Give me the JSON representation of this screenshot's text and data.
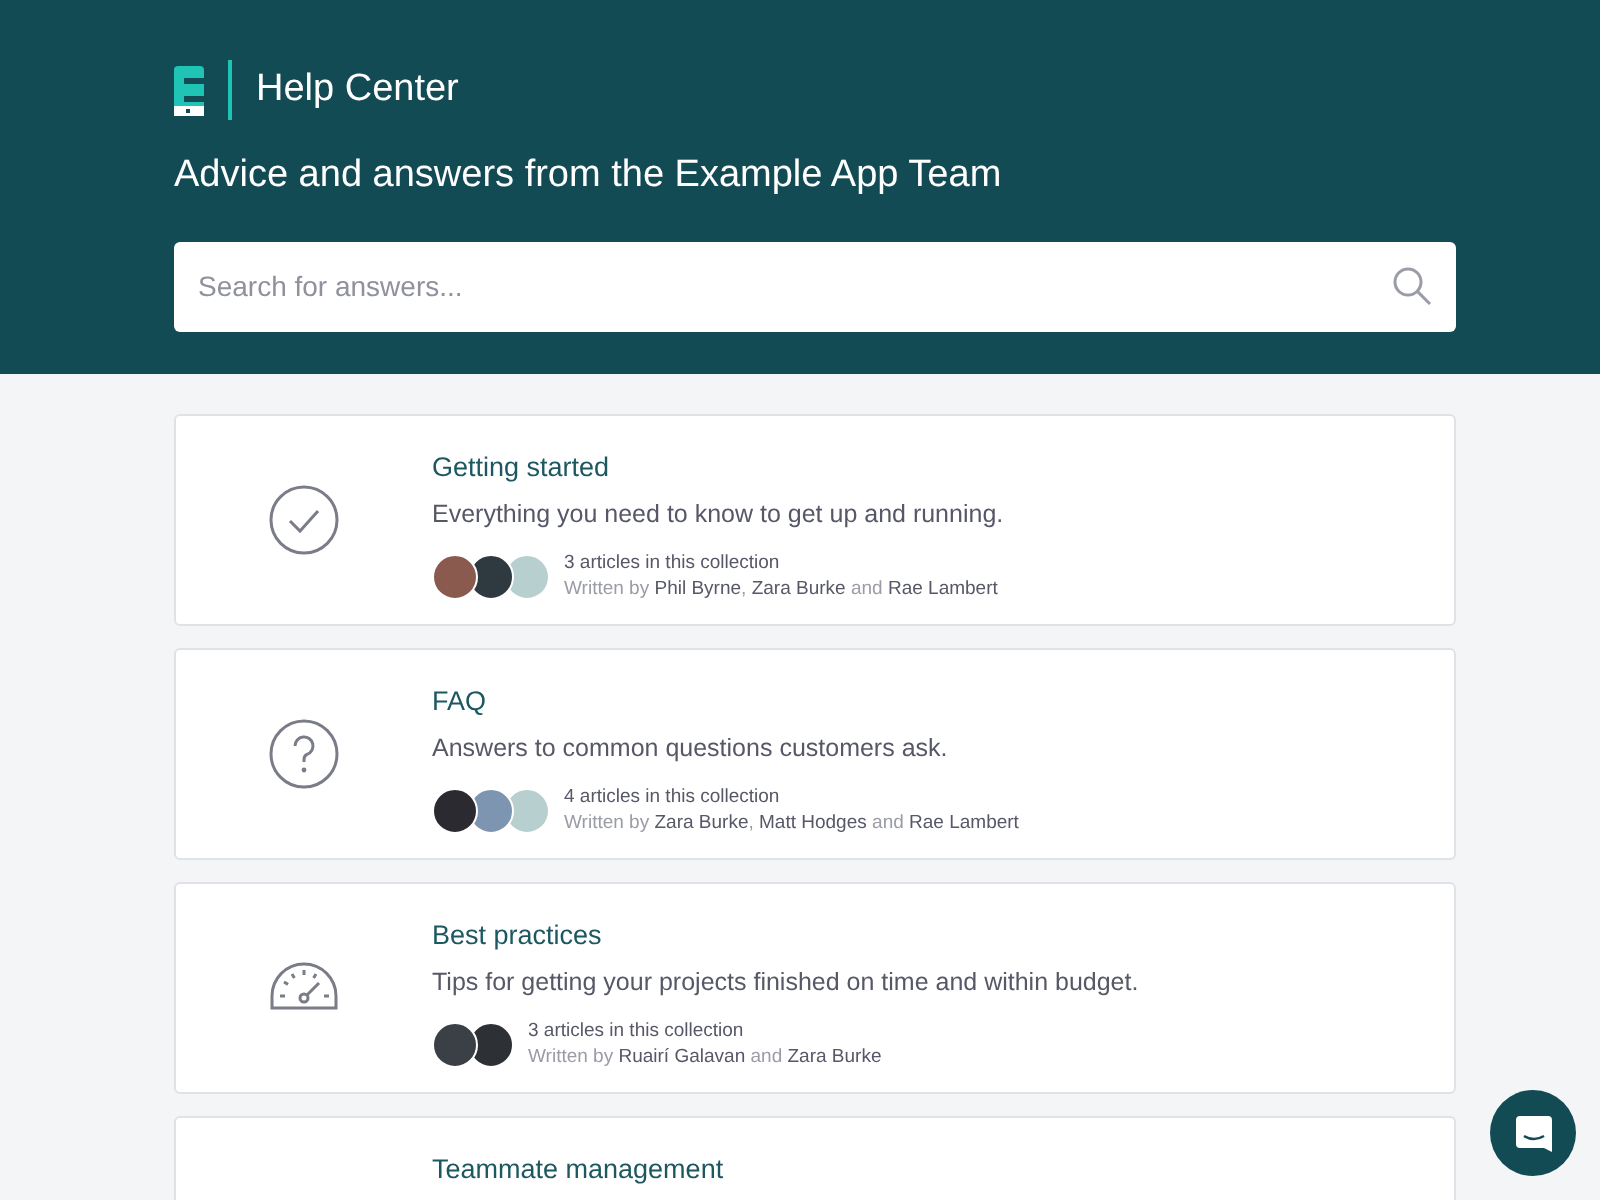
{
  "header": {
    "title": "Help Center",
    "tagline": "Advice and answers from the Example App Team"
  },
  "search": {
    "placeholder": "Search for answers..."
  },
  "collections": [
    {
      "kind": "check",
      "title": "Getting started",
      "description": "Everything you need to know to get up and running.",
      "avatars": [
        {
          "color": "#8a5a4e"
        },
        {
          "color": "#2f3a40"
        },
        {
          "color": "#b8cfcf"
        }
      ],
      "count": "3 articles in this collection",
      "byline": "Written by **Phil Byrne**, **Zara Burke** and **Rae Lambert**"
    },
    {
      "kind": "question",
      "title": "FAQ",
      "description": "Answers to common questions customers ask.",
      "avatars": [
        {
          "color": "#2a2a30"
        },
        {
          "color": "#7d95b0"
        },
        {
          "color": "#b8cfcf"
        }
      ],
      "count": "4 articles in this collection",
      "byline": "Written by **Zara Burke**, **Matt Hodges** and **Rae Lambert**"
    },
    {
      "kind": "gauge",
      "title": "Best practices",
      "description": "Tips for getting your projects finished on time and within budget.",
      "avatars": [
        {
          "color": "#3b3f46"
        },
        {
          "color": "#2d3035"
        }
      ],
      "count": "3 articles in this collection",
      "byline": "Written by **Ruairí Galavan** and **Zara Burke**"
    },
    {
      "title": "Teammate management"
    }
  ]
}
